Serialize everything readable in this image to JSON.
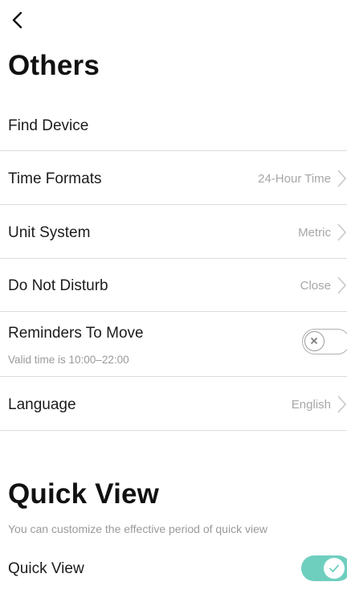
{
  "header": {
    "back_icon": "chevron-left-icon",
    "title": "Others"
  },
  "others": {
    "find_device": "Find Device",
    "time_formats": {
      "label": "Time Formats",
      "value": "24-Hour Time"
    },
    "unit_system": {
      "label": "Unit System",
      "value": "Metric"
    },
    "do_not_disturb": {
      "label": "Do Not Disturb",
      "value": "Close"
    },
    "reminders": {
      "label": "Reminders To Move",
      "subtitle": "Valid time is 10:00–22:00",
      "enabled": false
    },
    "language": {
      "label": "Language",
      "value": "English"
    }
  },
  "quick_view": {
    "title": "Quick View",
    "description": "You can customize the effective period of quick view",
    "toggle_label": "Quick View",
    "enabled": true
  },
  "colors": {
    "accent": "#6fcfbf",
    "divider": "#dcdcdc",
    "secondary_text": "#a6a6a6"
  }
}
